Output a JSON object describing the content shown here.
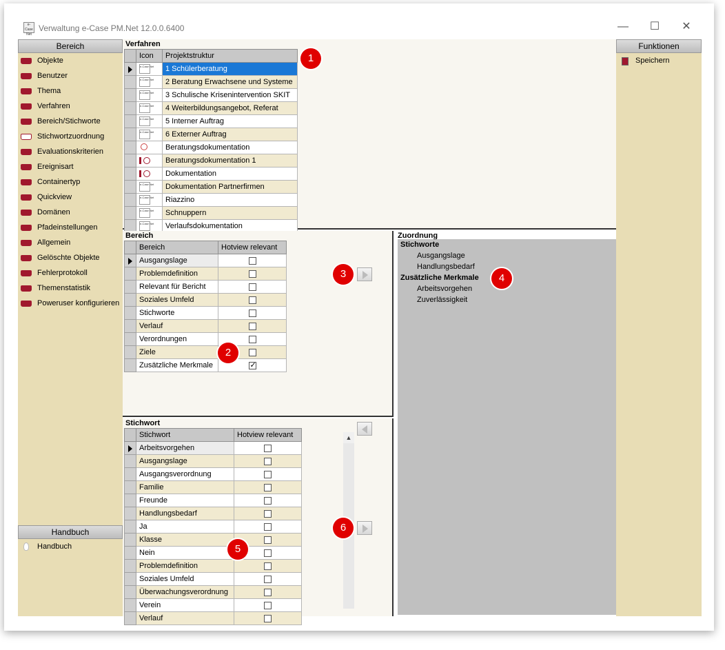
{
  "window": {
    "title": "Verwaltung e-Case PM.Net 12.0.0.6400",
    "icon_text": "e-Case Net",
    "minimize": "—",
    "maximize": "☐",
    "close": "✕"
  },
  "left_panel": {
    "header": "Bereich",
    "items": [
      {
        "label": "Objekte"
      },
      {
        "label": "Benutzer"
      },
      {
        "label": "Thema"
      },
      {
        "label": "Verfahren"
      },
      {
        "label": "Bereich/Stichworte"
      },
      {
        "label": "Stichwortzuordnung"
      },
      {
        "label": "Evaluationskriterien"
      },
      {
        "label": "Ereignisart"
      },
      {
        "label": "Containertyp"
      },
      {
        "label": "Quickview"
      },
      {
        "label": "Domänen"
      },
      {
        "label": "Pfadeinstellungen"
      },
      {
        "label": "Allgemein"
      },
      {
        "label": "Gelöschte Objekte"
      },
      {
        "label": "Fehlerprotokoll"
      },
      {
        "label": "Themenstatistik"
      },
      {
        "label": "Poweruser konfigurieren"
      }
    ],
    "selected_index": 5,
    "handbuch_header": "Handbuch",
    "handbuch_item": "Handbuch"
  },
  "right_panel": {
    "header": "Funktionen",
    "save_label": "Speichern"
  },
  "verfahren": {
    "title": "Verfahren",
    "columns": [
      "Icon",
      "Projektstruktur"
    ],
    "rows": [
      {
        "icon": "ecase",
        "label": "1 Schülerberatung",
        "selected": true
      },
      {
        "icon": "ecase",
        "label": "2 Beratung Erwachsene und Systeme"
      },
      {
        "icon": "ecase",
        "label": "3 Schulische Krisenintervention SKIT"
      },
      {
        "icon": "ecase",
        "label": "4 Weiterbildungsangebot, Referat"
      },
      {
        "icon": "ecase",
        "label": "5 Interner Auftrag"
      },
      {
        "icon": "ecase",
        "label": "6 Externer Auftrag"
      },
      {
        "icon": "magnifier",
        "label": "Beratungsdokumentation"
      },
      {
        "icon": "ring",
        "label": "Beratungsdokumentation 1"
      },
      {
        "icon": "ring",
        "label": "Dokumentation"
      },
      {
        "icon": "ecase",
        "label": "Dokumentation Partnerfirmen"
      },
      {
        "icon": "ecase",
        "label": "Riazzino"
      },
      {
        "icon": "ecase",
        "label": "Schnuppern"
      },
      {
        "icon": "ecase",
        "label": "Verlaufsdokumentation"
      }
    ]
  },
  "bereich": {
    "title": "Bereich",
    "columns": [
      "Bereich",
      "Hotview relevant"
    ],
    "rows": [
      {
        "label": "Ausgangslage",
        "checked": false
      },
      {
        "label": "Problemdefinition",
        "checked": false
      },
      {
        "label": "Relevant für Bericht",
        "checked": false
      },
      {
        "label": "Soziales Umfeld",
        "checked": false
      },
      {
        "label": "Stichworte",
        "checked": false
      },
      {
        "label": "Verlauf",
        "checked": false
      },
      {
        "label": "Verordnungen",
        "checked": false
      },
      {
        "label": "Ziele",
        "checked": false
      },
      {
        "label": "Zusätzliche Merkmale",
        "checked": true
      }
    ]
  },
  "stichwort": {
    "title": "Stichwort",
    "columns": [
      "Stichwort",
      "Hotview relevant"
    ],
    "rows": [
      {
        "label": "Arbeitsvorgehen",
        "checked": false
      },
      {
        "label": "Ausgangslage",
        "checked": false
      },
      {
        "label": "Ausgangsverordnung",
        "checked": false
      },
      {
        "label": "Familie",
        "checked": false
      },
      {
        "label": "Freunde",
        "checked": false
      },
      {
        "label": "Handlungsbedarf",
        "checked": false
      },
      {
        "label": "Ja",
        "checked": false
      },
      {
        "label": "Klasse",
        "checked": false
      },
      {
        "label": "Nein",
        "checked": false
      },
      {
        "label": "Problemdefinition",
        "checked": false
      },
      {
        "label": "Soziales Umfeld",
        "checked": false
      },
      {
        "label": "Überwachungsverordnung",
        "checked": false
      },
      {
        "label": "Verein",
        "checked": false
      },
      {
        "label": "Verlauf",
        "checked": false
      }
    ],
    "scroll_up": "▲"
  },
  "zuordnung": {
    "title": "Zuordnung",
    "groups": [
      {
        "label": "Stichworte",
        "items": [
          "Ausgangslage",
          "Handlungsbedarf"
        ]
      },
      {
        "label": "Zusätzliche Merkmale",
        "items": [
          "Arbeitsvorgehen",
          "Zuverlässigkeit"
        ]
      }
    ]
  },
  "badges": [
    "1",
    "2",
    "3",
    "4",
    "5",
    "6"
  ],
  "colors": {
    "panel": "#e8ddb5",
    "selection": "#1a78d6",
    "badge": "#e00000",
    "book": "#a0182e"
  }
}
